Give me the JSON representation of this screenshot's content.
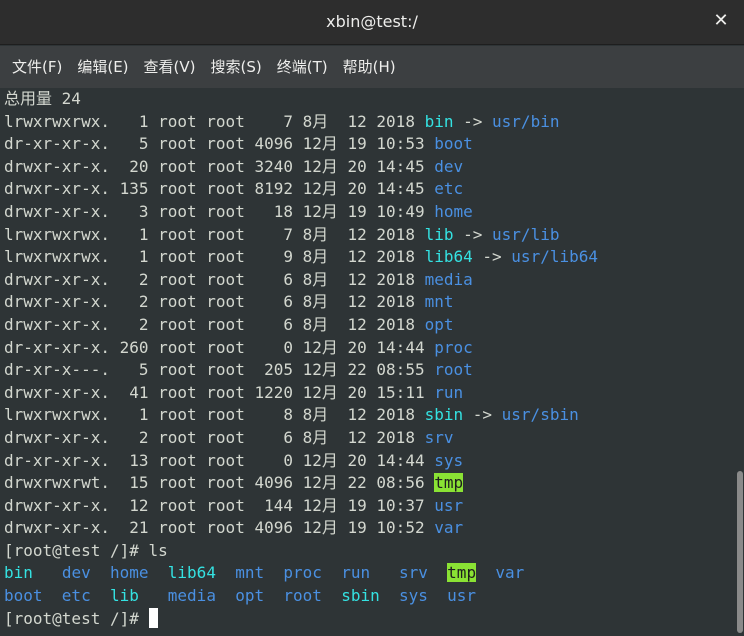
{
  "window": {
    "title": "xbin@test:/"
  },
  "menu": [
    {
      "label": "文件(F)"
    },
    {
      "label": "编辑(E)"
    },
    {
      "label": "查看(V)"
    },
    {
      "label": "搜索(S)"
    },
    {
      "label": "终端(T)"
    },
    {
      "label": "帮助(H)"
    }
  ],
  "terminal": {
    "total_line": "总用量 24",
    "listing": [
      {
        "prefix": "lrwxrwxrwx.   1 root root    7 8月  12 2018 ",
        "name": "bin",
        "kind": "link",
        "target": "usr/bin"
      },
      {
        "prefix": "dr-xr-xr-x.   5 root root 4096 12月 19 10:53 ",
        "name": "boot",
        "kind": "dir",
        "target": ""
      },
      {
        "prefix": "drwxr-xr-x.  20 root root 3240 12月 20 14:45 ",
        "name": "dev",
        "kind": "dir",
        "target": ""
      },
      {
        "prefix": "drwxr-xr-x. 135 root root 8192 12月 20 14:45 ",
        "name": "etc",
        "kind": "dir",
        "target": ""
      },
      {
        "prefix": "drwxr-xr-x.   3 root root   18 12月 19 10:49 ",
        "name": "home",
        "kind": "dir",
        "target": ""
      },
      {
        "prefix": "lrwxrwxrwx.   1 root root    7 8月  12 2018 ",
        "name": "lib",
        "kind": "link",
        "target": "usr/lib"
      },
      {
        "prefix": "lrwxrwxrwx.   1 root root    9 8月  12 2018 ",
        "name": "lib64",
        "kind": "link",
        "target": "usr/lib64"
      },
      {
        "prefix": "drwxr-xr-x.   2 root root    6 8月  12 2018 ",
        "name": "media",
        "kind": "dir",
        "target": ""
      },
      {
        "prefix": "drwxr-xr-x.   2 root root    6 8月  12 2018 ",
        "name": "mnt",
        "kind": "dir",
        "target": ""
      },
      {
        "prefix": "drwxr-xr-x.   2 root root    6 8月  12 2018 ",
        "name": "opt",
        "kind": "dir",
        "target": ""
      },
      {
        "prefix": "dr-xr-xr-x. 260 root root    0 12月 20 14:44 ",
        "name": "proc",
        "kind": "dir",
        "target": ""
      },
      {
        "prefix": "dr-xr-x---.   5 root root  205 12月 22 08:55 ",
        "name": "root",
        "kind": "dir",
        "target": ""
      },
      {
        "prefix": "drwxr-xr-x.  41 root root 1220 12月 20 15:11 ",
        "name": "run",
        "kind": "dir",
        "target": ""
      },
      {
        "prefix": "lrwxrwxrwx.   1 root root    8 8月  12 2018 ",
        "name": "sbin",
        "kind": "link",
        "target": "usr/sbin"
      },
      {
        "prefix": "drwxr-xr-x.   2 root root    6 8月  12 2018 ",
        "name": "srv",
        "kind": "dir",
        "target": ""
      },
      {
        "prefix": "dr-xr-xr-x.  13 root root    0 12月 20 14:44 ",
        "name": "sys",
        "kind": "dir",
        "target": ""
      },
      {
        "prefix": "drwxrwxrwt.  15 root root 4096 12月 22 08:56 ",
        "name": "tmp",
        "kind": "sticky",
        "target": ""
      },
      {
        "prefix": "drwxr-xr-x.  12 root root  144 12月 19 10:37 ",
        "name": "usr",
        "kind": "dir",
        "target": ""
      },
      {
        "prefix": "drwxr-xr-x.  21 root root 4096 12月 19 10:52 ",
        "name": "var",
        "kind": "dir",
        "target": ""
      }
    ],
    "link_arrow": " -> ",
    "ls_prompt": "[root@test /]# ls",
    "ls_row1": [
      {
        "name": "bin",
        "kind": "link"
      },
      {
        "name": "dev",
        "kind": "dir"
      },
      {
        "name": "home",
        "kind": "dir"
      },
      {
        "name": "lib64",
        "kind": "link"
      },
      {
        "name": "mnt",
        "kind": "dir"
      },
      {
        "name": "proc",
        "kind": "dir"
      },
      {
        "name": "run",
        "kind": "dir"
      },
      {
        "name": "srv",
        "kind": "dir"
      },
      {
        "name": "tmp",
        "kind": "sticky"
      },
      {
        "name": "var",
        "kind": "dir"
      }
    ],
    "ls_row2": [
      {
        "name": "boot",
        "kind": "dir"
      },
      {
        "name": "etc",
        "kind": "dir"
      },
      {
        "name": "lib",
        "kind": "link"
      },
      {
        "name": "media",
        "kind": "dir"
      },
      {
        "name": "opt",
        "kind": "dir"
      },
      {
        "name": "root",
        "kind": "dir"
      },
      {
        "name": "sbin",
        "kind": "link"
      },
      {
        "name": "sys",
        "kind": "dir"
      },
      {
        "name": "usr",
        "kind": "dir"
      }
    ],
    "final_prompt": "[root@test /]# "
  },
  "colors": {
    "background": "#2e3436",
    "text": "#d3d7cf",
    "directory": "#4a90e2",
    "symlink": "#34e2e2",
    "sticky_bg": "#8ae234"
  }
}
